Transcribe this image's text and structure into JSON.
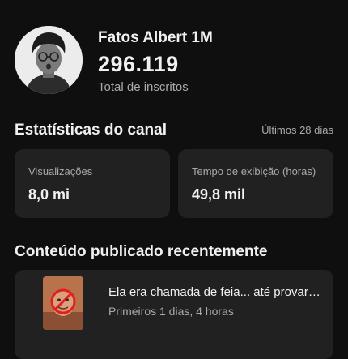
{
  "channel": {
    "name": "Fatos Albert 1M",
    "subscribers": "296.119",
    "subscribers_label": "Total de inscritos"
  },
  "stats": {
    "title": "Estatísticas do canal",
    "period": "Últimos 28 dias",
    "cards": [
      {
        "label": "Visualizações",
        "value": "8,0 mi"
      },
      {
        "label": "Tempo de exibição (horas)",
        "value": "49,8 mil"
      }
    ]
  },
  "recent": {
    "title": "Conteúdo publicado recentemente",
    "items": [
      {
        "title": "Ela era chamada de feia... até provar que era linda",
        "meta": "Primeiros 1 dias, 4 horas"
      }
    ]
  }
}
